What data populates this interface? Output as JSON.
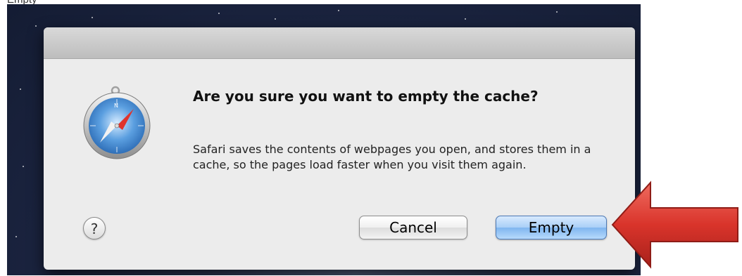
{
  "page": {
    "partial_top_text": "Empty"
  },
  "dialog": {
    "app_icon": "safari-compass-icon",
    "heading": "Are you sure you want to empty the cache?",
    "message": "Safari saves the contents of webpages you open, and stores them in a cache, so the pages load faster when you visit them again.",
    "help_label": "?",
    "cancel_label": "Cancel",
    "confirm_label": "Empty"
  },
  "annotation": {
    "icon": "red-arrow-icon",
    "color": "#d9342b"
  },
  "colors": {
    "dialog_background": "#ececec",
    "default_button": "#8fc0f3",
    "desktop_background": "#1b2440"
  }
}
